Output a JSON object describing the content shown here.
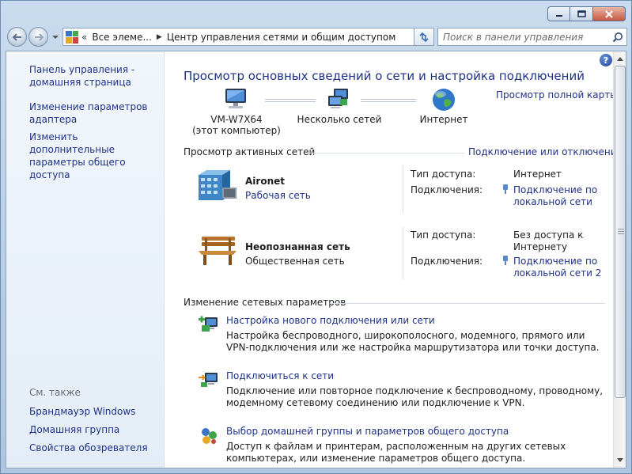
{
  "nav": {
    "crumb_more": "«",
    "crumb_1": "Все элеме...",
    "crumb_2": "Центр управления сетями и общим доступом",
    "search_placeholder": "Поиск в панели управления"
  },
  "sidebar": {
    "links": [
      {
        "label": "Панель управления - домашняя страница"
      },
      {
        "label": "Изменение параметров адаптера"
      },
      {
        "label": "Изменить дополнительные параметры общего доступа"
      }
    ],
    "see_also_label": "См. также",
    "see_also": [
      {
        "label": "Брандмауэр Windows"
      },
      {
        "label": "Домашняя группа"
      },
      {
        "label": "Свойства обозревателя"
      }
    ]
  },
  "main": {
    "help_glyph": "?",
    "title": "Просмотр основных сведений о сети и настройка подключений",
    "full_map_link": "Просмотр полной карты",
    "map": {
      "computer_name": "VM-W7X64",
      "computer_sub": "(этот компьютер)",
      "middle": "Несколько сетей",
      "internet": "Интернет"
    },
    "active_header": "Просмотр активных сетей",
    "connect_link": "Подключение или отключение",
    "networks": [
      {
        "name": "Aironet",
        "category": "Рабочая сеть",
        "access_label": "Тип доступа:",
        "access_value": "Интернет",
        "conn_label": "Подключения:",
        "conn_value": "Подключение по локальной сети"
      },
      {
        "name": "Неопознанная сеть",
        "category": "Общественная сеть",
        "access_label": "Тип доступа:",
        "access_value": "Без доступа к Интернету",
        "conn_label": "Подключения:",
        "conn_value": "Подключение по локальной сети 2"
      }
    ],
    "change_header": "Изменение сетевых параметров",
    "tasks": [
      {
        "title": "Настройка нового подключения или сети",
        "desc": "Настройка беспроводного, широкополосного, модемного, прямого или VPN-подключения или же настройка маршрутизатора или точки доступа."
      },
      {
        "title": "Подключиться к сети",
        "desc": "Подключение или повторное подключение к беспроводному, проводному, модемному сетевому соединению или подключение к VPN."
      },
      {
        "title": "Выбор домашней группы и параметров общего доступа",
        "desc": "Доступ к файлам и принтерам, расположенным на других сетевых компьютерах, или изменение параметров общего доступа."
      }
    ]
  },
  "colors": {
    "link": "#1e3287",
    "title": "#1e3287",
    "window_frame": "#b7cde4"
  }
}
